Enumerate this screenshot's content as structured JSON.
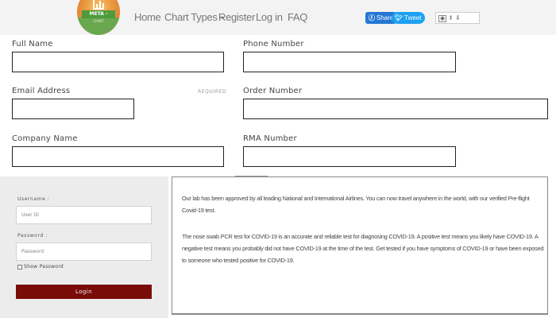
{
  "nav": {
    "logo_text": "META -",
    "logo_subtext": "CHART",
    "items": [
      "Home",
      "Chart Types",
      "Register",
      "Log in",
      "FAQ"
    ],
    "share_label": "Share",
    "tweet_label": "Tweet",
    "share_icon": "facebook-icon",
    "tweet_icon": "twitter-bird-icon"
  },
  "form": {
    "full_name_label": "Full Name",
    "phone_label": "Phone Number",
    "email_label": "Email Address",
    "required_label": "REQUIRED",
    "order_label": "Order Number",
    "company_label": "Company Name",
    "rma_label": "RMA Number"
  },
  "login": {
    "username_label": "Username :",
    "username_placeholder": "User ID",
    "password_label": "Password :",
    "password_placeholder": "Password",
    "show_password_label": "Show Password",
    "button_label": "Login",
    "button_color": "#7a0c08"
  },
  "info": {
    "paragraph1": "Our lab has been approved by all leading National and International Airlines. You can now travel anywhere in the world, with our verified Pre-flight Covid-19 test.",
    "paragraph2": "The nose swab PCR test for COVID-19 is an accurate and reliable test for diagnosing COVID-19. A positive test means you likely have COVID-19. A negative test means you probably did not have COVID-19 at the time of the test. Get tested if you have symptoms of COVID-19 or have been exposed to someone who tested positive for COVID-19."
  }
}
